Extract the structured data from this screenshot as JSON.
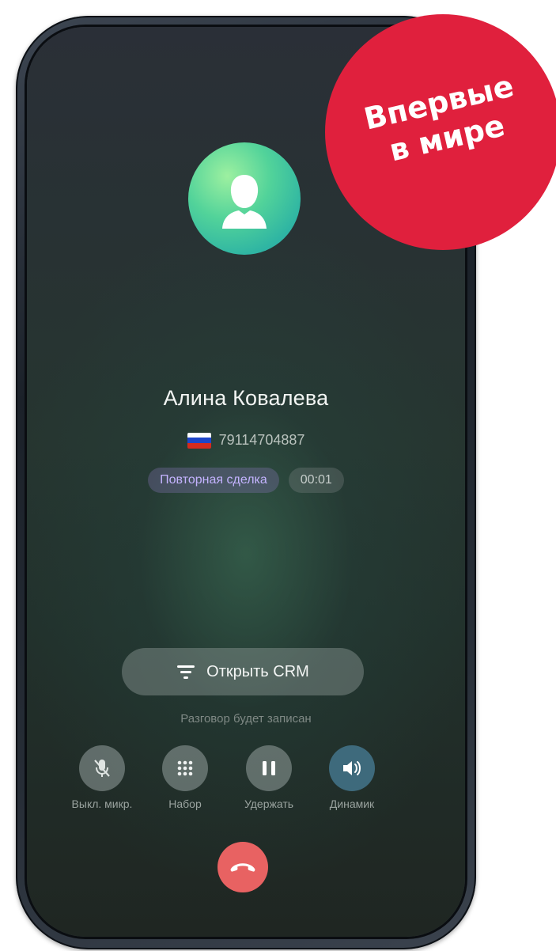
{
  "contact": {
    "name": "Алина Ковалева",
    "phone": "79114704887",
    "flag_colors": [
      "#ffffff",
      "#1e46c8",
      "#d52b1e"
    ]
  },
  "badges": {
    "deal": "Повторная сделка",
    "timer": "00:01"
  },
  "crm_button": {
    "label": "Открыть CRM",
    "icon": "filter-icon"
  },
  "record_note": "Разговор будет записан",
  "controls": [
    {
      "label": "Выкл. микр.",
      "icon": "mic-off-icon",
      "active": false
    },
    {
      "label": "Набор",
      "icon": "keypad-icon",
      "active": false
    },
    {
      "label": "Удержать",
      "icon": "pause-icon",
      "active": false
    },
    {
      "label": "Динамик",
      "icon": "speaker-icon",
      "active": true
    }
  ],
  "hangup": {
    "icon": "hangup-icon",
    "color": "#e86262"
  },
  "promo": {
    "line1": "Впервые",
    "line2": "в мире",
    "color": "#e0203d"
  }
}
